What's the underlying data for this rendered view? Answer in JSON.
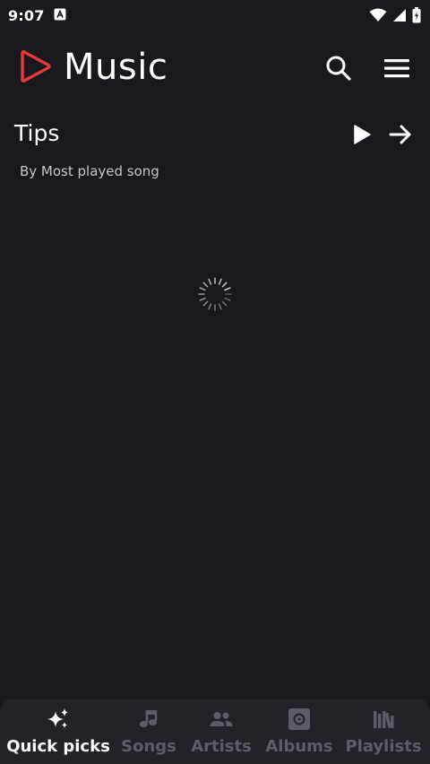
{
  "status_bar": {
    "time": "9:07"
  },
  "app_bar": {
    "title": "Music",
    "accent_color": "#e0393e"
  },
  "section": {
    "title": "Tips",
    "subtitle": "By Most played song"
  },
  "bottom_nav": {
    "items": [
      {
        "label": "Quick picks",
        "icon": "sparkles-icon",
        "active": true
      },
      {
        "label": "Songs",
        "icon": "music-note-icon",
        "active": false
      },
      {
        "label": "Artists",
        "icon": "people-icon",
        "active": false
      },
      {
        "label": "Albums",
        "icon": "album-icon",
        "active": false
      },
      {
        "label": "Playlists",
        "icon": "library-icon",
        "active": false
      }
    ]
  },
  "colors": {
    "background": "#18181d",
    "nav_background": "#222228",
    "inactive": "#5c5c66",
    "text": "#ffffff"
  }
}
